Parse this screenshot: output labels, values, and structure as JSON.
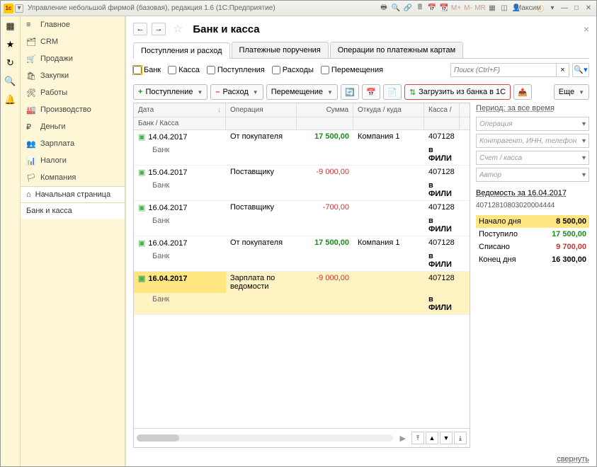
{
  "titlebar": {
    "title": "Управление небольшой фирмой (базовая), редакция 1.6  (1С:Предприятие)",
    "user": "Максим"
  },
  "sidebar": {
    "items": [
      {
        "icon": "≡",
        "label": "Главное"
      },
      {
        "icon": "🗂",
        "label": "CRM"
      },
      {
        "icon": "🛒",
        "label": "Продажи"
      },
      {
        "icon": "🛍",
        "label": "Закупки"
      },
      {
        "icon": "🛠",
        "label": "Работы"
      },
      {
        "icon": "🏭",
        "label": "Производство"
      },
      {
        "icon": "₽",
        "label": "Деньги"
      },
      {
        "icon": "👥",
        "label": "Зарплата"
      },
      {
        "icon": "📊",
        "label": "Налоги"
      },
      {
        "icon": "🏳",
        "label": "Компания"
      }
    ],
    "home": "Начальная страница",
    "sub": "Банк и касса"
  },
  "page": {
    "title": "Банк и касса",
    "tabs": [
      "Поступления и расход",
      "Платежные поручения",
      "Операции по платежным картам"
    ],
    "filters": {
      "bank": "Банк",
      "kassa": "Касса",
      "income": "Поступления",
      "expense": "Расходы",
      "move": "Перемещения"
    },
    "search_ph": "Поиск (Ctrl+F)",
    "toolbar": {
      "add": "Поступление",
      "expense": "Расход",
      "move": "Перемещение",
      "load": "Загрузить из банка в 1С",
      "more": "Еще"
    },
    "grid": {
      "cols": {
        "date": "Дата",
        "bank": "Банк / Касса",
        "op": "Операция",
        "sum": "Сумма",
        "where": "Откуда / куда",
        "kassa": "Касса /"
      },
      "rows": [
        {
          "date": "14.04.2017",
          "bank": "Банк",
          "op": "От покупателя",
          "sum": "17 500,00",
          "sumcls": "amount-pos",
          "where": "Компания 1",
          "kassa": "407128",
          "kassa2": "в ФИЛИ"
        },
        {
          "date": "15.04.2017",
          "bank": "Банк",
          "op": "Поставщику",
          "sum": "-9 000,00",
          "sumcls": "amount-neg",
          "where": "",
          "kassa": "407128",
          "kassa2": "в ФИЛИ"
        },
        {
          "date": "16.04.2017",
          "bank": "Банк",
          "op": "Поставщику",
          "sum": "-700,00",
          "sumcls": "amount-neg",
          "where": "",
          "kassa": "407128",
          "kassa2": "в ФИЛИ"
        },
        {
          "date": "16.04.2017",
          "bank": "Банк",
          "op": "От покупателя",
          "sum": "17 500,00",
          "sumcls": "amount-pos",
          "where": "Компания 1",
          "kassa": "407128",
          "kassa2": "в ФИЛИ"
        },
        {
          "date": "16.04.2017",
          "bank": "Банк",
          "op": "Зарплата по ведомости",
          "sum": "-9 000,00",
          "sumcls": "amount-neg",
          "where": "",
          "kassa": "407128",
          "kassa2": "в ФИЛИ",
          "sel": true
        }
      ]
    },
    "side": {
      "period": "Период: за все время",
      "f_op": "Операция",
      "f_ka": "Контрагент, ИНН, телефон",
      "f_acc": "Счет / касса",
      "f_auth": "Автор",
      "vtitle": "Ведомость за 16.04.2017",
      "acct": "40712810803020004444",
      "rows": [
        {
          "l": "Начало дня",
          "v": "8 500,00",
          "cls": "",
          "hl": true
        },
        {
          "l": "Поступило",
          "v": "17 500,00",
          "cls": "amount-pos"
        },
        {
          "l": "Списано",
          "v": "9 700,00",
          "cls": "amount-neg"
        },
        {
          "l": "Конец дня",
          "v": "16 300,00",
          "cls": ""
        }
      ]
    },
    "collapse": "свернуть"
  }
}
